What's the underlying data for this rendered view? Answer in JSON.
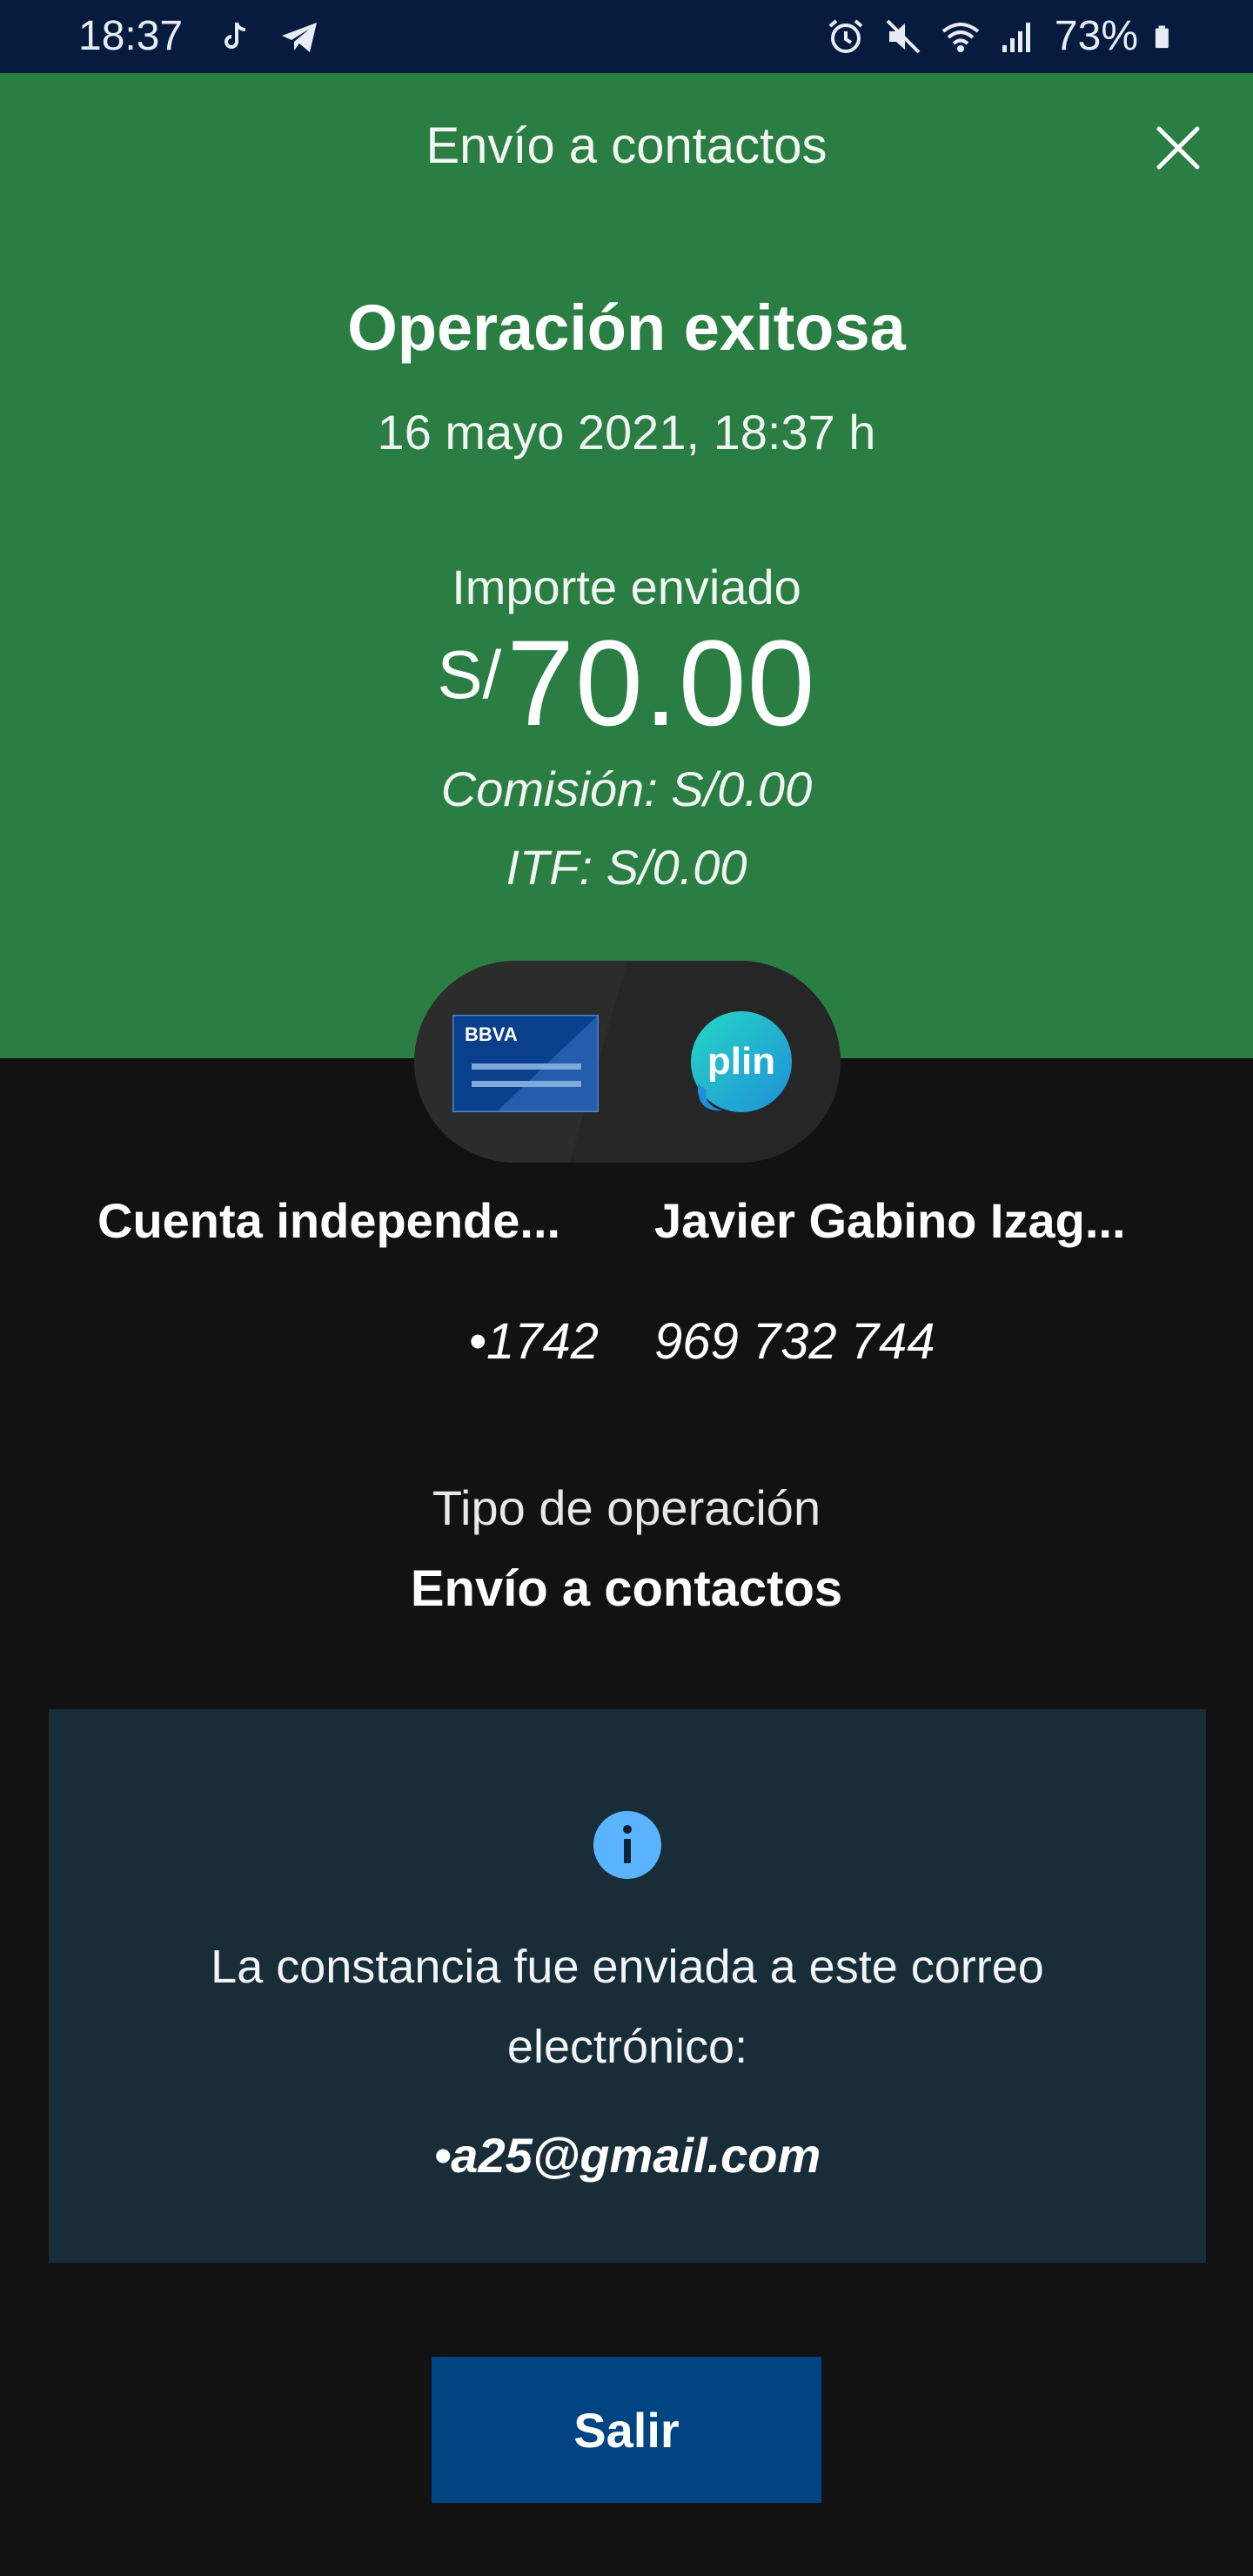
{
  "status_bar": {
    "time": "18:37",
    "battery_percent": "73%",
    "left_icons": [
      "tiktok-icon",
      "telegram-icon"
    ],
    "right_icons": [
      "alarm-icon",
      "mute-icon",
      "wifi-icon",
      "signal-icon",
      "battery-icon"
    ]
  },
  "header": {
    "title": "Envío a contactos",
    "close_icon": "close-icon",
    "background_color": "#2a7e43"
  },
  "operation": {
    "status": "Operación exitosa",
    "datetime": "16 mayo 2021, 18:37 h",
    "amount_label": "Importe enviado",
    "currency": "S/",
    "amount": "70.00",
    "commission": "Comisión:  S/0.00",
    "itf": "ITF:  S/0.00"
  },
  "transfer": {
    "origin_logo": "BBVA",
    "dest_logo": "plin",
    "origin_name": "Cuenta independe...",
    "origin_detail": "•1742",
    "dest_name": "Javier Gabino Izag...",
    "dest_detail": "969 732 744"
  },
  "operation_type": {
    "label": "Tipo de operación",
    "value": "Envío a contactos"
  },
  "info": {
    "icon": "info-icon",
    "message": "La constancia fue enviada a este correo electrónico:",
    "email": "•a25@gmail.com"
  },
  "actions": {
    "exit_label": "Salir",
    "button_color": "#004481"
  }
}
